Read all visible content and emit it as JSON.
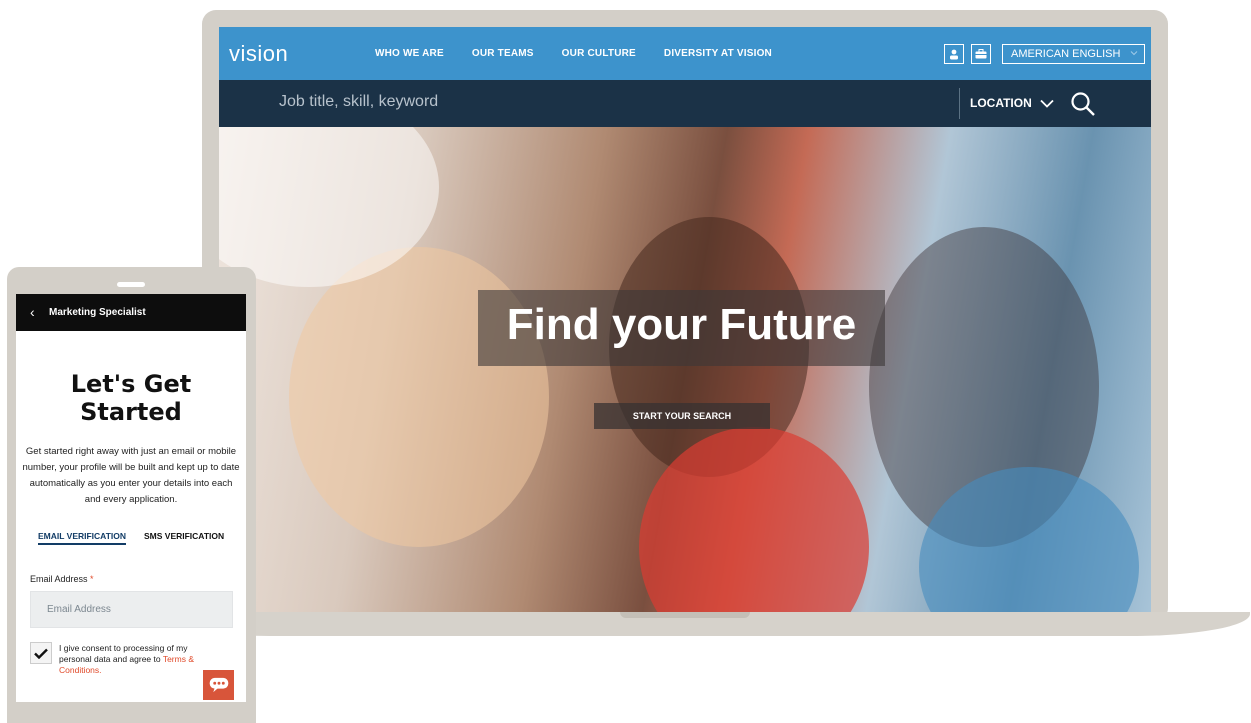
{
  "desktop": {
    "logo": "vision",
    "nav": [
      "WHO WE ARE",
      "OUR TEAMS",
      "OUR CULTURE",
      "DIVERSITY AT VISION"
    ],
    "language": "AMERICAN ENGLISH",
    "search_placeholder": "Job title, skill, keyword",
    "location_label": "LOCATION",
    "hero_title": "Find your Future",
    "hero_button": "START YOUR SEARCH",
    "icons": [
      "user-icon",
      "briefcase-icon",
      "chevron-down-icon",
      "search-icon",
      "chat-icon"
    ]
  },
  "mobile": {
    "header_title": "Marketing Specialist",
    "heading": "Let's Get Started",
    "description": "Get started right away with just an email or mobile number, your profile will be built and kept up to date automatically as you enter your details into each and every application.",
    "tabs": [
      "EMAIL VERIFICATION",
      "SMS VERIFICATION"
    ],
    "email_label": "Email Address",
    "required_marker": "*",
    "email_placeholder": "Email Address",
    "consent_text": "I give consent to processing of my personal data and agree to",
    "consent_link": "Terms & Conditions",
    "consent_end": "."
  },
  "colors": {
    "topbar": "#3d93cc",
    "searchbar": "#1b3247",
    "accent": "#d8553a",
    "tab_active": "#123c66"
  }
}
